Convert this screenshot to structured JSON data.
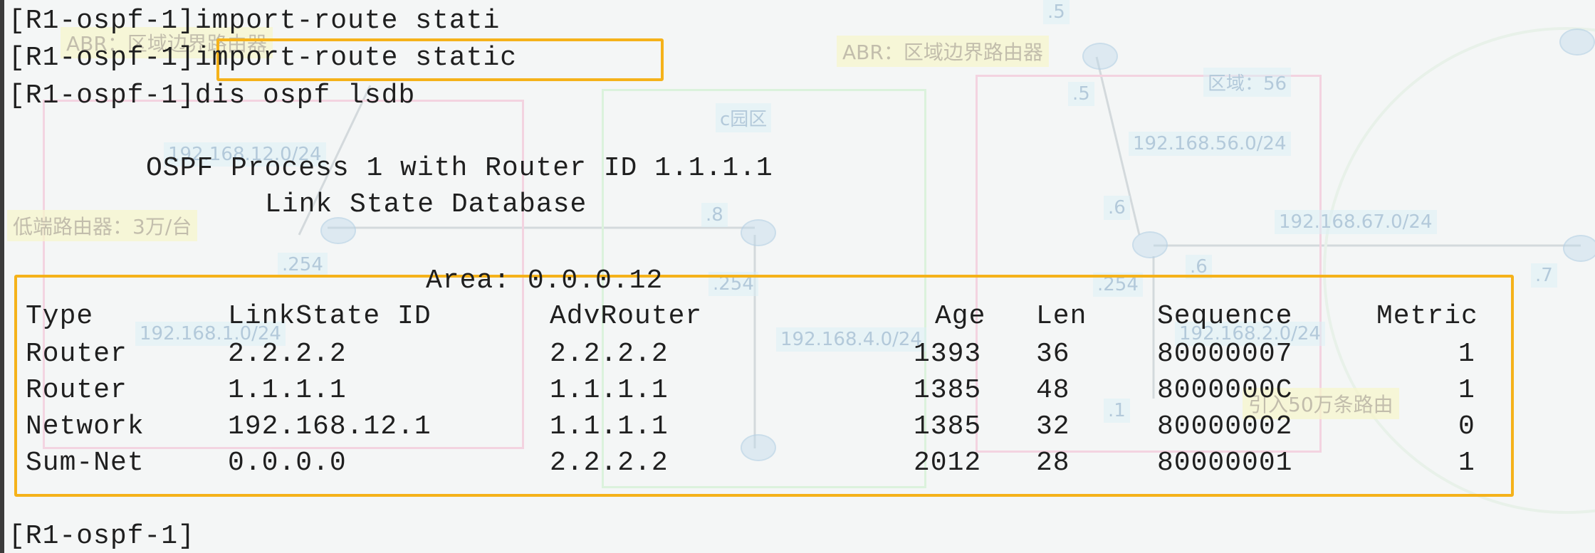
{
  "colors": {
    "highlight": "#f5b21a",
    "text": "#1f1f1f",
    "background": "#f4f6f6"
  },
  "background_diagram": {
    "labels": {
      "abr_left": "ABR：区域边界路由器",
      "abr_right": "ABR：区域边界路由器",
      "area_56": "区域：56",
      "c_park": "c园区",
      "low_end": "低端路由器：3万/台",
      "import_routes": "引入50万条路由",
      "net_12": "192.168.12.0/24",
      "net_56": "192.168.56.0/24",
      "net_67": "192.168.67.0/24",
      "net_1": "192.168.1.0/24",
      "net_4": "192.168.4.0/24",
      "net_2": "192.168.2.0/24",
      "dot5a": ".5",
      "dot5b": ".5",
      "dot6a": ".6",
      "dot6b": ".6",
      "dot8": ".8",
      "dot254a": ".254",
      "dot254b": ".254",
      "dot254c": ".254",
      "dot7": ".7",
      "dot1": ".1"
    }
  },
  "terminal": {
    "lines": [
      "[R1-ospf-1]import-route stati",
      "[R1-ospf-1]import-route static",
      "[R1-ospf-1]dis ospf lsdb",
      "OSPF Process 1 with Router ID 1.1.1.1",
      "Link State Database",
      "Area: 0.0.0.12",
      "[R1-ospf-1]"
    ],
    "table": {
      "headers": [
        "Type",
        "LinkState ID",
        "AdvRouter",
        "Age",
        "Len",
        "Sequence",
        "Metric"
      ],
      "rows": [
        [
          "Router",
          "2.2.2.2",
          "2.2.2.2",
          "1393",
          "36",
          "80000007",
          "1"
        ],
        [
          "Router",
          "1.1.1.1",
          "1.1.1.1",
          "1385",
          "48",
          "8000000C",
          "1"
        ],
        [
          "Network",
          "192.168.12.1",
          "1.1.1.1",
          "1385",
          "32",
          "80000002",
          "0"
        ],
        [
          "Sum-Net",
          "0.0.0.0",
          "2.2.2.2",
          "2012",
          "28",
          "80000001",
          "1"
        ]
      ]
    }
  }
}
